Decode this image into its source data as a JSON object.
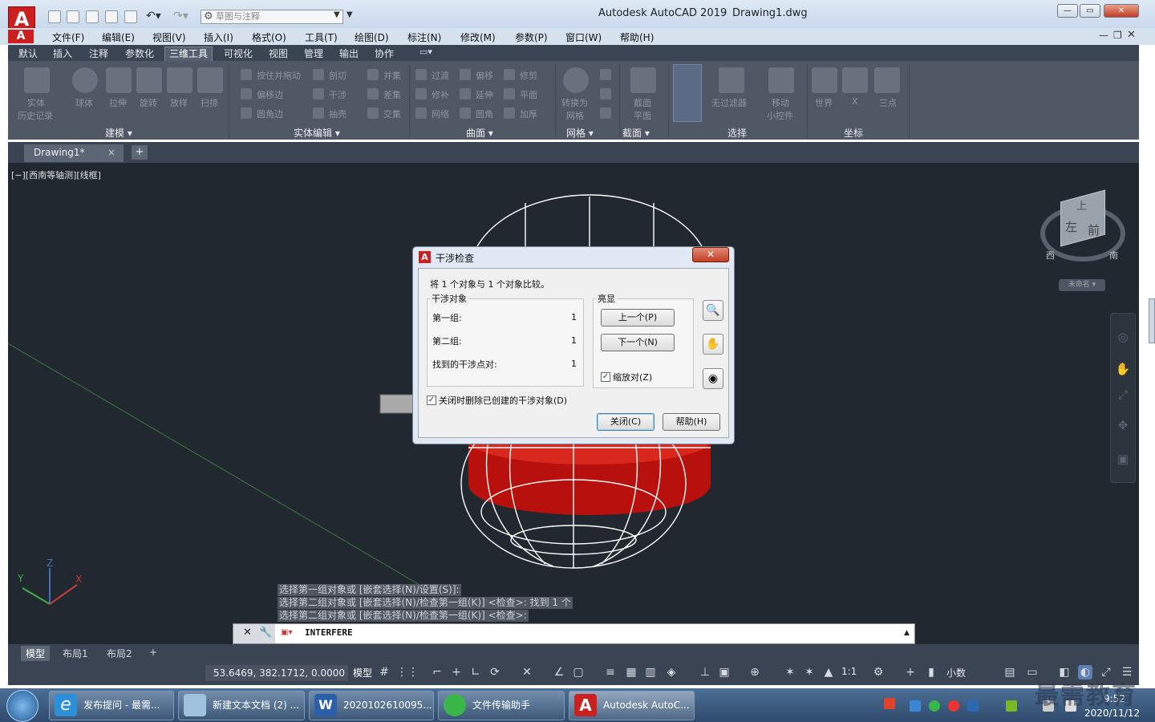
{
  "window": {
    "app_title": "Autodesk AutoCAD 2019",
    "doc_title": "Drawing1.dwg",
    "logo_letter": "A"
  },
  "qat": {
    "workspace": "草图与注释"
  },
  "menu": [
    "文件(F)",
    "编辑(E)",
    "视图(V)",
    "插入(I)",
    "格式(O)",
    "工具(T)",
    "绘图(D)",
    "标注(N)",
    "修改(M)",
    "参数(P)",
    "窗口(W)",
    "帮助(H)"
  ],
  "ribbon_tabs": [
    "默认",
    "插入",
    "注释",
    "参数化",
    "三维工具",
    "可视化",
    "视图",
    "管理",
    "输出",
    "协作"
  ],
  "ribbon_active": "三维工具",
  "ribbon": {
    "modeling": {
      "title": "建模 ▾",
      "history": [
        "实体",
        "历史记录"
      ],
      "tools": [
        "球体",
        "拉伸",
        "旋转",
        "放样",
        "扫掠"
      ]
    },
    "solid_edit": {
      "title": "实体编辑 ▾",
      "col1": [
        "按住并拖动",
        "偏移边",
        "圆角边"
      ],
      "col2": [
        "剖切",
        "干涉",
        "抽壳"
      ],
      "col3": [
        "并集",
        "差集",
        "交集"
      ]
    },
    "surface": {
      "title": "曲面 ▾",
      "col1": [
        "过渡",
        "修补",
        "网络"
      ],
      "col2": [
        "偏移",
        "延伸",
        "圆角"
      ],
      "col3": [
        "修剪",
        "平面",
        "加厚"
      ]
    },
    "mesh": {
      "title": "网格 ▾",
      "convert": [
        "转换为",
        "网格"
      ]
    },
    "section": {
      "title": "截面 ▾",
      "plane": [
        "截面",
        "平面"
      ]
    },
    "select": {
      "title": "选择",
      "tools": [
        "无过滤器",
        "移动",
        "小控件"
      ]
    },
    "coords": {
      "title": "坐标",
      "tools": [
        "世界",
        "X",
        "三点"
      ]
    }
  },
  "file_tab": {
    "name": "Drawing1*",
    "close": "×",
    "add": "+"
  },
  "viewport": {
    "label": "[−][西南等轴测][线框]",
    "viewcube": {
      "top": "上",
      "left": "左",
      "front": "前",
      "west": "西",
      "south": "南",
      "ucs": "未命名 ▾"
    }
  },
  "dialog": {
    "title": "干涉检查",
    "close": "✕",
    "summary": "将 1 个对象与 1 个对象比较。",
    "group_title": "干涉对象",
    "rows": [
      {
        "label": "第一组:",
        "value": "1"
      },
      {
        "label": "第二组:",
        "value": "1"
      },
      {
        "label": "找到的干涉点对:",
        "value": "1"
      }
    ],
    "highlight_title": "亮显",
    "prev": "上一个(P)",
    "next": "下一个(N)",
    "zoom_check": "缩放对(Z)",
    "delete_check": "关闭时删除已创建的干涉对象(D)",
    "close_btn": "关闭(C)",
    "help_btn": "帮助(H)"
  },
  "command": {
    "history": [
      "选择第一组对象或 [嵌套选择(N)/设置(S)]:",
      "选择第二组对象或 [嵌套选择(N)/检查第一组(K)] <检查>: 找到 1 个",
      "选择第二组对象或 [嵌套选择(N)/检查第一组(K)] <检查>:"
    ],
    "input": "INTERFERE"
  },
  "layouts": [
    "模型",
    "布局1",
    "布局2",
    "+"
  ],
  "status": {
    "coords": "53.6469, 382.1712, 0.0000",
    "model": "模型",
    "scale": "1:1",
    "units": "小数"
  },
  "taskbar": {
    "items": [
      "发布提问 - 最需...",
      "新建文本文档 (2) ...",
      "2020102610095...",
      "文件传输助手",
      "Autodesk AutoC..."
    ],
    "time": "2020/11/12",
    "time_partial": "9:52"
  },
  "watermark": "最需教育",
  "colors": {
    "ribbon": "#505866",
    "viewport": "#212830",
    "solid": "#c0120f",
    "accent": "#cc1f1f"
  }
}
